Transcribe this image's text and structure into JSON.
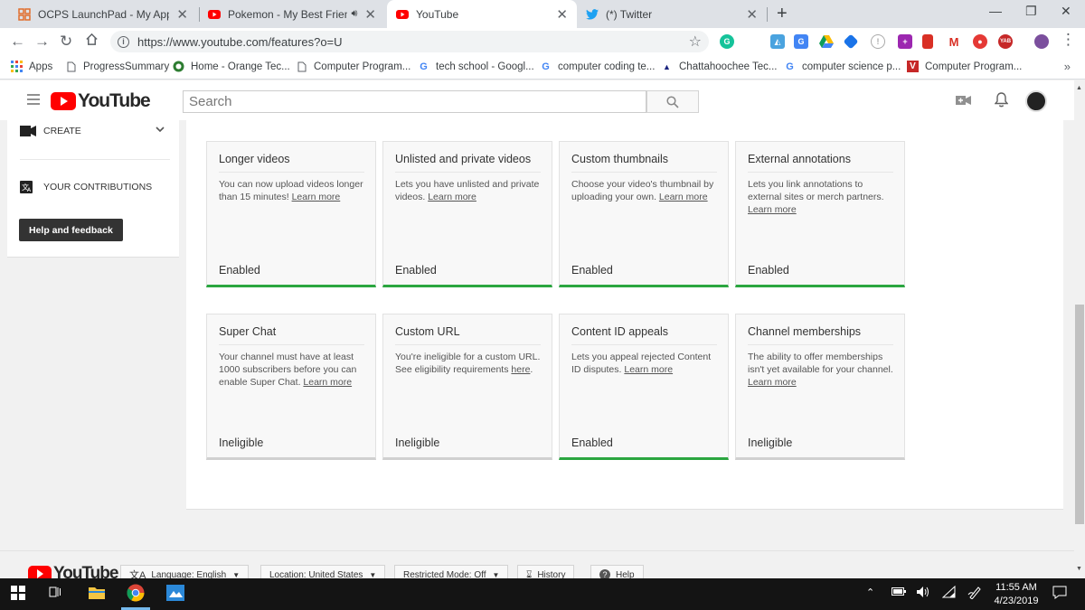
{
  "browser": {
    "tabs": [
      {
        "title": "OCPS LaunchPad - My Apps",
        "icon": "grid-favicon"
      },
      {
        "title": "Pokemon - My Best Friends (",
        "icon": "youtube-favicon",
        "audio": true
      },
      {
        "title": "YouTube",
        "icon": "youtube-favicon",
        "active": true
      },
      {
        "title": "(*) Twitter",
        "icon": "twitter-favicon"
      }
    ],
    "url": "https://www.youtube.com/features?o=U",
    "bookmarks": [
      {
        "label": "Apps",
        "icon": "apps-grid-icon"
      },
      {
        "label": "ProgressSummary",
        "icon": "page-icon"
      },
      {
        "label": "Home - Orange Tec...",
        "icon": "orange-tech-icon"
      },
      {
        "label": "Computer Program...",
        "icon": "page-icon"
      },
      {
        "label": "tech school - Googl...",
        "icon": "google-icon"
      },
      {
        "label": "computer coding te...",
        "icon": "google-icon"
      },
      {
        "label": "Chattahoochee Tec...",
        "icon": "college-icon"
      },
      {
        "label": "computer science p...",
        "icon": "google-icon"
      },
      {
        "label": "Computer Program...",
        "icon": "v-icon"
      }
    ]
  },
  "youtube": {
    "logo_text": "YouTube",
    "search_placeholder": "Search"
  },
  "left_panel": {
    "create_label": "CREATE",
    "contributions_label": "YOUR CONTRIBUTIONS",
    "help_button": "Help and feedback"
  },
  "features": [
    {
      "title": "Longer videos",
      "desc": "You can now upload videos longer than 15 minutes!",
      "link": "Learn more",
      "status": "Enabled",
      "enabled": true
    },
    {
      "title": "Unlisted and private videos",
      "desc": "Lets you have unlisted and private videos.",
      "link": "Learn more",
      "status": "Enabled",
      "enabled": true
    },
    {
      "title": "Custom thumbnails",
      "desc": "Choose your video's thumbnail by uploading your own.",
      "link": "Learn more",
      "status": "Enabled",
      "enabled": true
    },
    {
      "title": "External annotations",
      "desc": "Lets you link annotations to external sites or merch partners.",
      "link": "Learn more",
      "status": "Enabled",
      "enabled": true
    },
    {
      "title": "Super Chat",
      "desc": "Your channel must have at least 1000 subscribers before you can enable Super Chat.",
      "link": "Learn more",
      "status": "Ineligible",
      "enabled": false
    },
    {
      "title": "Custom URL",
      "desc": "You're ineligible for a custom URL. See eligibility requirements",
      "link": "here",
      "link_suffix": ".",
      "status": "Ineligible",
      "enabled": false
    },
    {
      "title": "Content ID appeals",
      "desc": "Lets you appeal rejected Content ID disputes.",
      "link": "Learn more",
      "status": "Enabled",
      "enabled": true
    },
    {
      "title": "Channel memberships",
      "desc": "The ability to offer memberships isn't yet available for your channel.",
      "link": "Learn more",
      "status": "Ineligible",
      "enabled": false
    }
  ],
  "footer": {
    "logo_text": "YouTube",
    "language": "Language: English",
    "location": "Location: United States",
    "restricted": "Restricted Mode: Off",
    "history": "History",
    "help": "Help"
  },
  "taskbar": {
    "time": "11:55 AM",
    "date": "4/23/2019"
  },
  "colors": {
    "enabled_bar": "#2ba640",
    "youtube_red": "#ff0000"
  }
}
